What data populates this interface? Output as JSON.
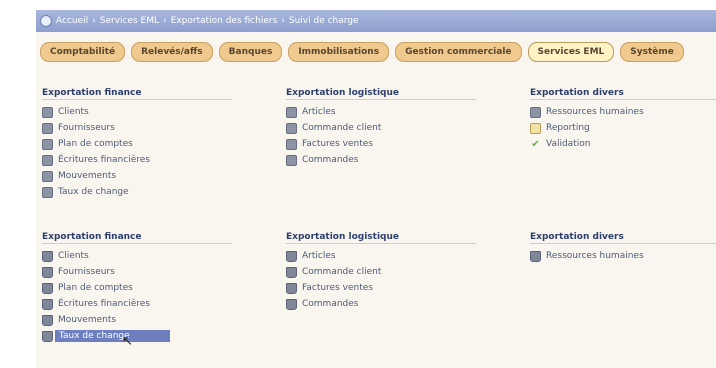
{
  "breadcrumb": [
    "Accueil",
    "Services EML",
    "Exportation des fichiers",
    "Suivi de charge"
  ],
  "tabs": [
    {
      "label": "Comptabilité"
    },
    {
      "label": "Relevés/affs"
    },
    {
      "label": "Banques"
    },
    {
      "label": "Immobilisations"
    },
    {
      "label": "Gestion commerciale"
    },
    {
      "label": "Services EML",
      "active": true
    },
    {
      "label": "Système"
    }
  ],
  "upper": {
    "finance": {
      "title": "Exportation finance",
      "items": [
        "Clients",
        "Fournisseurs",
        "Plan de comptes",
        "Écritures financières",
        "Mouvements",
        "Taux de change"
      ]
    },
    "logistique": {
      "title": "Exportation logistique",
      "items": [
        "Articles",
        "Commande client",
        "Factures ventes",
        "Commandes"
      ]
    },
    "divers": {
      "title": "Exportation divers",
      "items": [
        "Ressources humaines",
        "Reporting",
        "Validation"
      ]
    }
  },
  "lower": {
    "finance": {
      "title": "Exportation finance",
      "items": [
        "Clients",
        "Fournisseurs",
        "Plan de comptes",
        "Écritures financières",
        "Mouvements",
        "Taux de change"
      ]
    },
    "logistique": {
      "title": "Exportation logistique",
      "items": [
        "Articles",
        "Commande client",
        "Factures ventes",
        "Commandes"
      ]
    },
    "divers": {
      "title": "Exportation divers",
      "items": [
        "Ressources humaines"
      ]
    }
  },
  "icons": {
    "upper": "file-icon",
    "lower": "database-icon",
    "doc": "document-icon",
    "check": "checkmark-icon"
  },
  "colors": {
    "titlebar": "#8d9fcf",
    "tab": "#f0c98e",
    "selection": "#6e7fbf"
  }
}
